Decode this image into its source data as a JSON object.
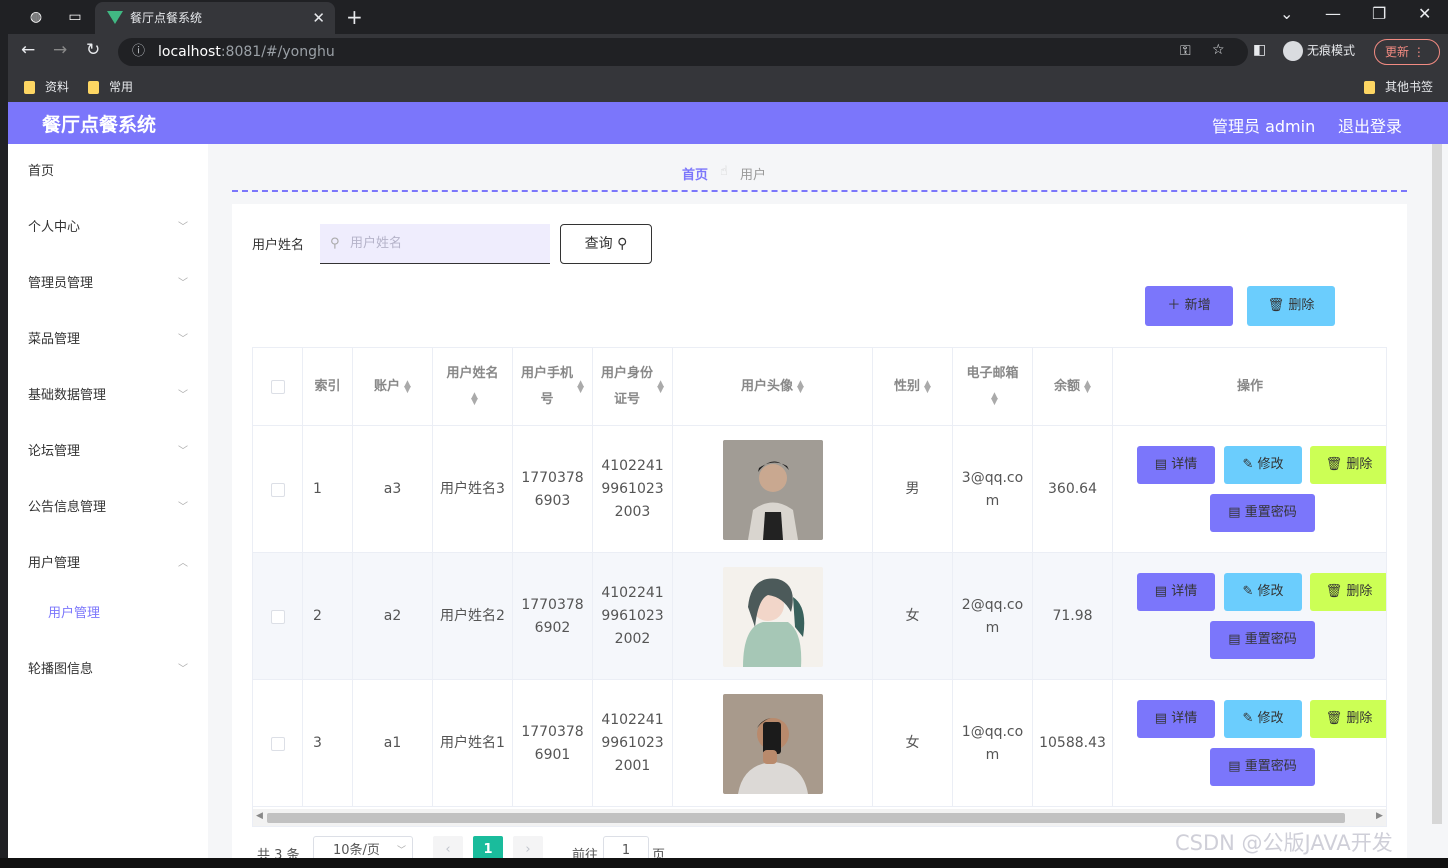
{
  "browser": {
    "tab_title": "餐厅点餐系统",
    "url_host": "localhost",
    "url_rest": ":8081/#/yonghu",
    "incognito_label": "无痕模式",
    "update_label": "更新",
    "bookmarks": [
      "资料",
      "常用"
    ],
    "other_bookmarks": "其他书签"
  },
  "header": {
    "title": "餐厅点餐系统",
    "admin": "管理员 admin",
    "logout": "退出登录",
    "accent": "#7b76fb"
  },
  "sidebar": {
    "items": [
      "首页",
      "个人中心",
      "管理员管理",
      "菜品管理",
      "基础数据管理",
      "论坛管理",
      "公告信息管理",
      "用户管理",
      "轮播图信息"
    ],
    "sub_item": "用户管理"
  },
  "breadcrumb": {
    "home": "首页",
    "current": "用户"
  },
  "search": {
    "label": "用户姓名",
    "placeholder": "用户姓名",
    "button": "查询"
  },
  "actions": {
    "add": "新增",
    "delete": "删除"
  },
  "table": {
    "headers": [
      "索引",
      "账户",
      "用户姓名",
      "用户手机号",
      "用户身份证号",
      "用户头像",
      "性别",
      "电子邮箱",
      "余额",
      "操作"
    ],
    "rows": [
      {
        "index": "1",
        "account": "a3",
        "name": "用户姓名3",
        "phone": "17703786903",
        "idcard": "410224199610232003",
        "gender": "男",
        "email": "3@qq.com",
        "balance": "360.64"
      },
      {
        "index": "2",
        "account": "a2",
        "name": "用户姓名2",
        "phone": "17703786902",
        "idcard": "410224199610232002",
        "gender": "女",
        "email": "2@qq.com",
        "balance": "71.98"
      },
      {
        "index": "3",
        "account": "a1",
        "name": "用户姓名1",
        "phone": "17703786901",
        "idcard": "410224199610232001",
        "gender": "女",
        "email": "1@qq.com",
        "balance": "10588.43"
      }
    ],
    "op_labels": {
      "detail": "详情",
      "edit": "修改",
      "delete": "删除",
      "reset": "重置密码"
    }
  },
  "pager": {
    "total": "共 3 条",
    "size": "10条/页",
    "page": "1",
    "goto": "前往",
    "goto_value": "1",
    "page_unit": "页"
  },
  "watermark": "CSDN @公版JAVA开发"
}
